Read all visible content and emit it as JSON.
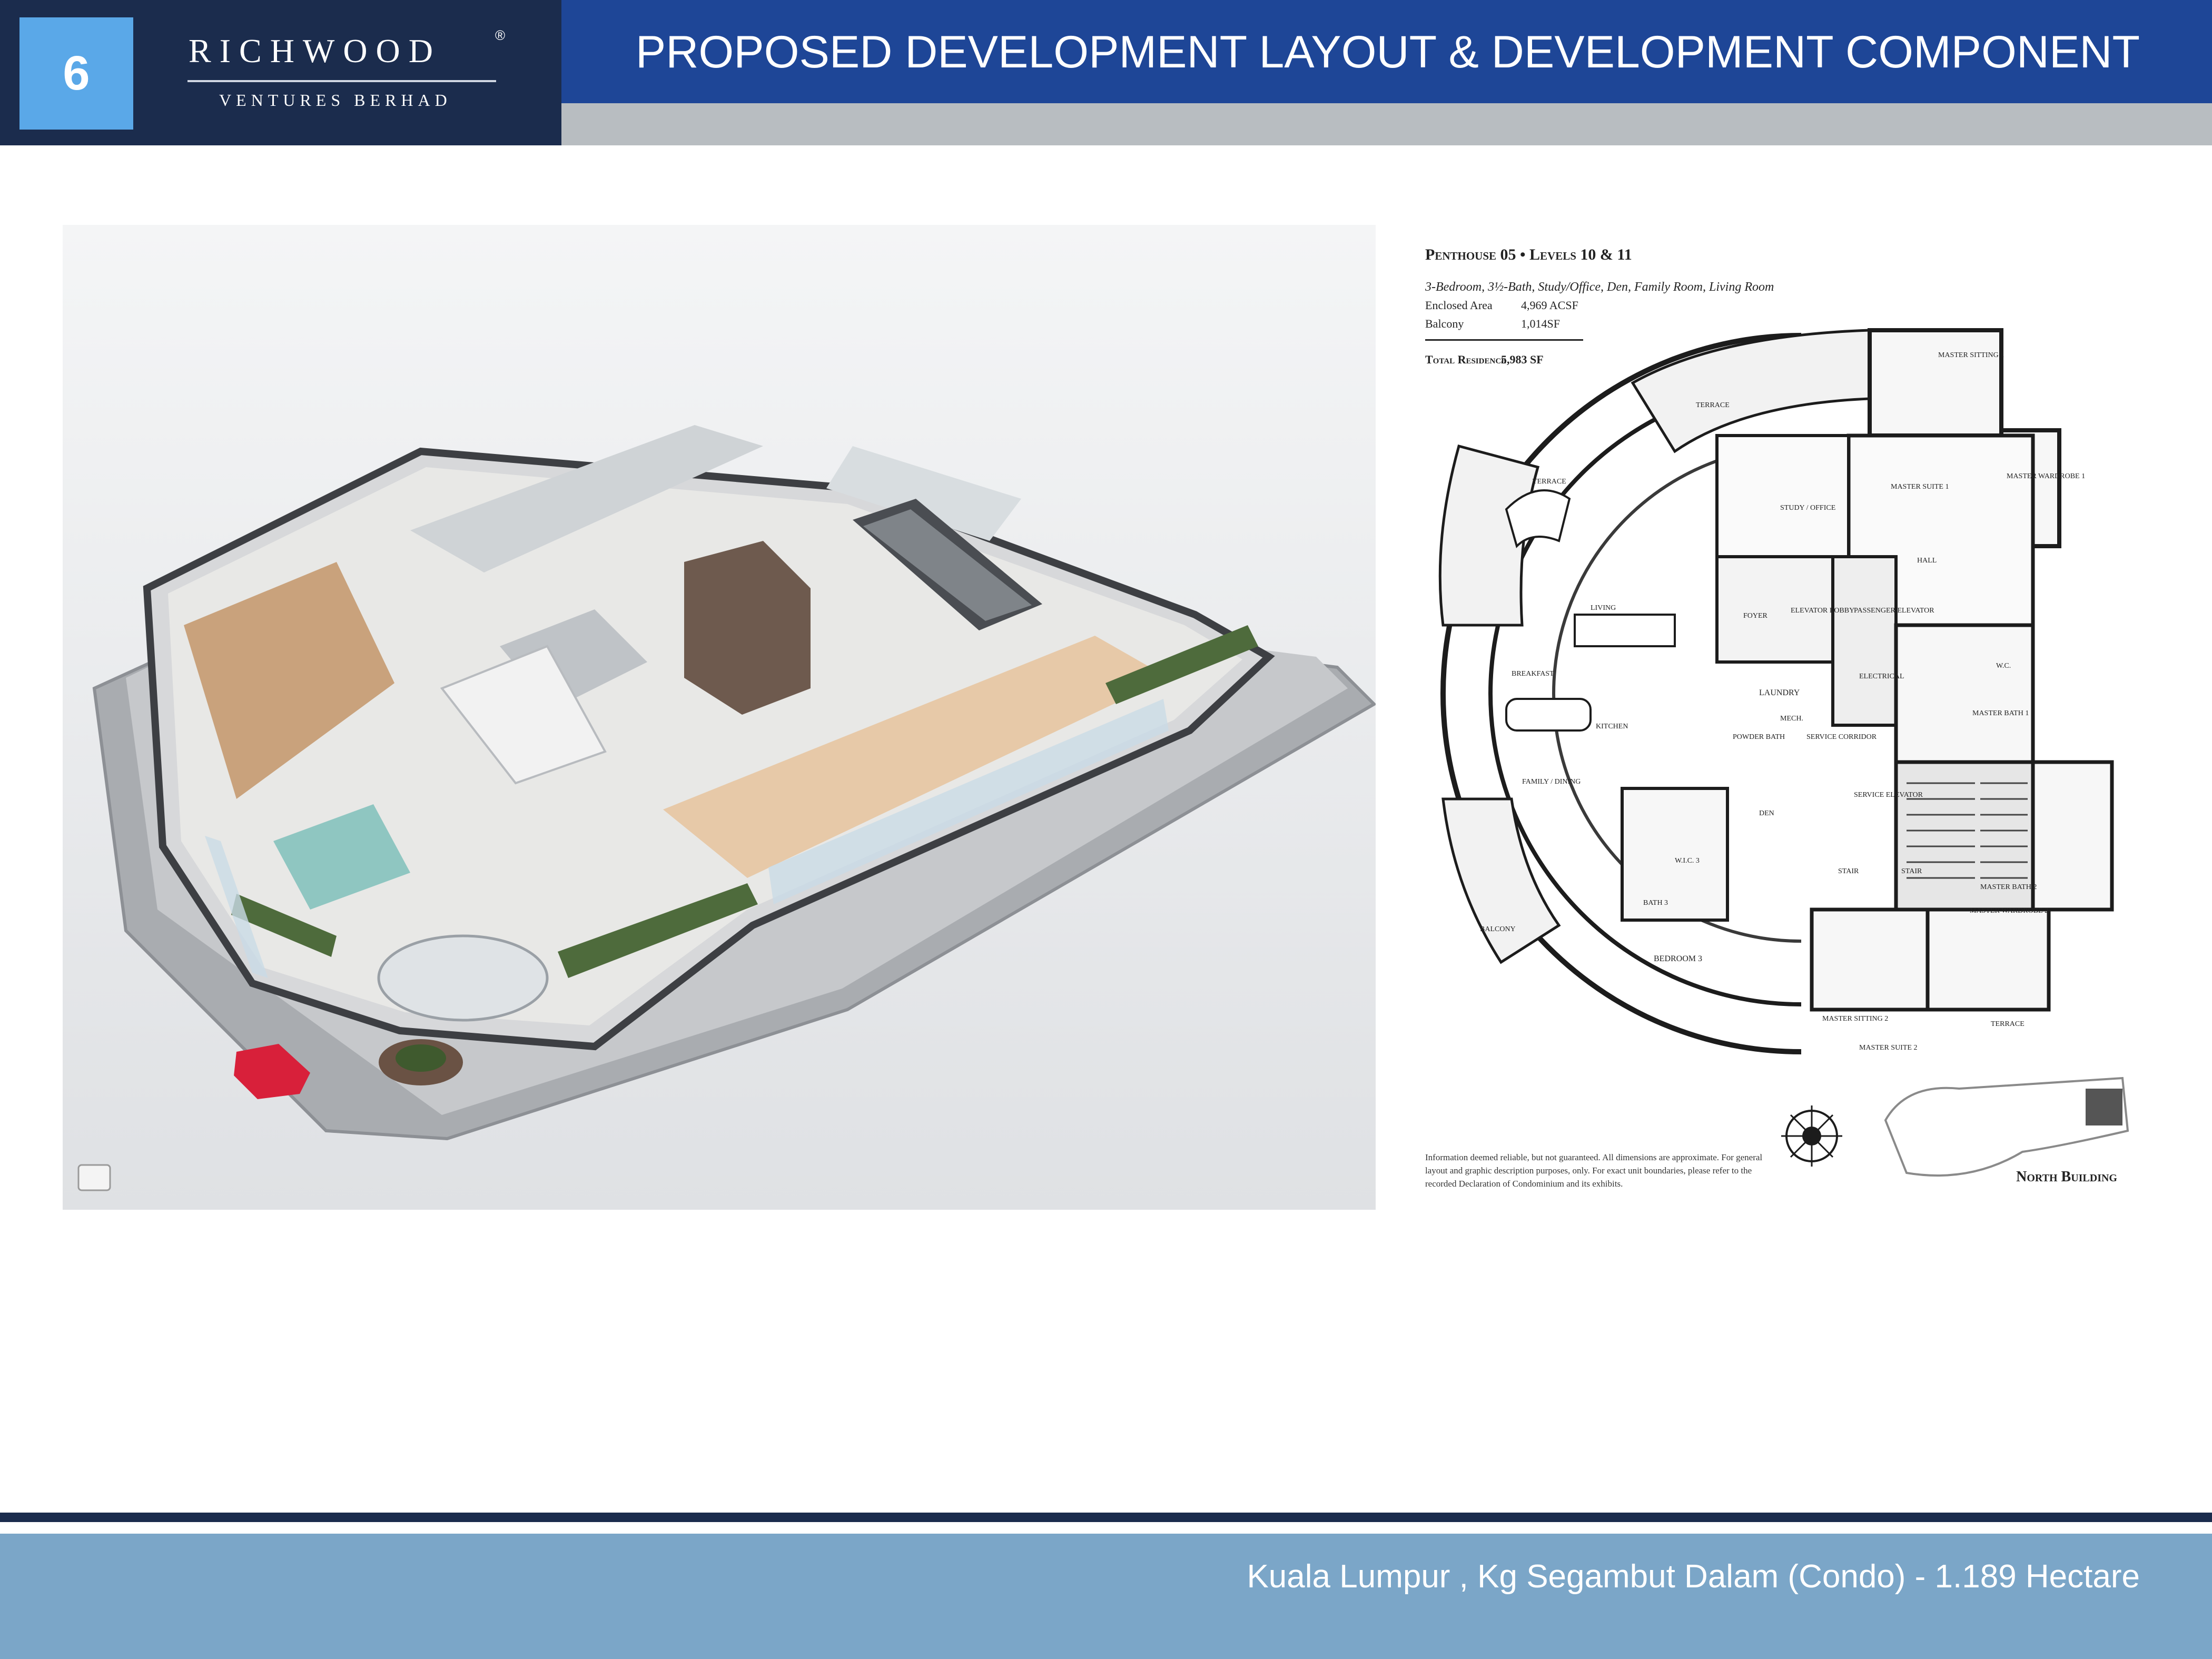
{
  "header": {
    "page_number": "6",
    "brand_name": "RICHWOOD",
    "brand_mark": "®",
    "brand_subtitle": "VENTURES BERHAD",
    "title": "PROPOSED DEVELOPMENT LAYOUT & DEVELOPMENT COMPONENT"
  },
  "floor_plan": {
    "title": "Penthouse 05 • Levels 10 & 11",
    "subtitle": "3-Bedroom, 3½-Bath, Study/Office, Den, Family Room, Living Room",
    "enclosed_area_label": "Enclosed Area",
    "enclosed_area_value": "4,969  ACSF",
    "balcony_label": "Balcony",
    "balcony_value": "1,014SF",
    "total_label": "Total Residence",
    "total_value": "5,983  SF",
    "disclaimer": "Information deemed reliable, but not guaranteed. All dimensions are approximate. For general layout and graphic description purposes, only. For exact unit boundaries, please refer to the recorded Declaration of Condominium and its exhibits.",
    "building_label": "North Building",
    "rooms": {
      "master_sitting_1": "MASTER SITTING 1",
      "terrace_top": "TERRACE",
      "terrace_left": "TERRACE",
      "master_suite_1": "MASTER SUITE 1",
      "master_wardrobe_1": "MASTER WARDROBE 1",
      "study": "STUDY / OFFICE",
      "hall_top": "HALL",
      "living": "LIVING",
      "foyer": "FOYER",
      "elevator_lobby": "ELEVATOR LOBBY",
      "passenger_elevator": "PASSENGER ELEVATOR",
      "breakfast": "BREAKFAST",
      "kitchen": "KITCHEN",
      "laundry": "LAUNDRY",
      "mech": "MECH.",
      "electrical": "ELECTRICAL",
      "master_bath_1": "MASTER BATH 1",
      "wc": "W.C.",
      "powder_bath": "POWDER BATH",
      "service_corridor": "SERVICE CORRIDOR",
      "family_dining": "FAMILY / DINING",
      "den": "DEN",
      "service_elevator": "SERVICE ELEVATOR",
      "stair_1": "STAIR",
      "stair_2": "STAIR",
      "master_bath_2": "MASTER BATH 2",
      "master_wardrobe_2": "MASTER WARDROBE 2",
      "wic_3": "W.I.C. 3",
      "bath_3": "BATH 3",
      "balcony": "BALCONY",
      "bedroom_3": "BEDROOM 3",
      "master_sitting_2": "MASTER SITTING 2",
      "master_suite_2": "MASTER SUITE 2",
      "terrace_right": "TERRACE"
    }
  },
  "footer": {
    "location": "Kuala Lumpur , Kg Segambut Dalam (Condo) - 1.189 Hectare"
  },
  "colors": {
    "navy": "#1b2c4d",
    "header_blue": "#1e4697",
    "badge_blue": "#5aa8e8",
    "header_grey": "#b8bdc1",
    "footer_blue": "#7ba6c8"
  }
}
